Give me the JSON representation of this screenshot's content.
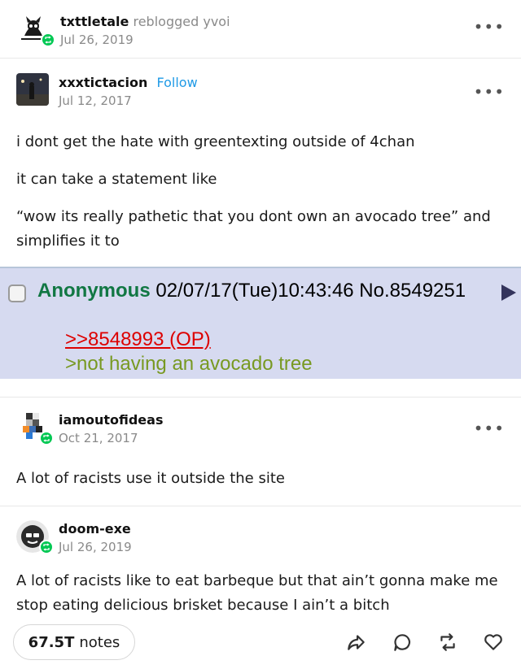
{
  "reblogger": {
    "name": "txttletale",
    "action": "reblogged",
    "source": "yvoi",
    "date": "Jul 26, 2019"
  },
  "posts": [
    {
      "author": "xxxtictacion",
      "follow_label": "Follow",
      "date": "Jul 12, 2017",
      "paragraphs": [
        "i dont get the hate with greentexting outside of 4chan",
        "it can take a statement like",
        "“wow its really pathetic that you dont own an avocado tree” and simplifies it to"
      ],
      "chan_post": {
        "name": "Anonymous",
        "meta": "02/07/17(Tue)10:43:46 No.8549251",
        "reply_link": ">>8548993 (OP)",
        "greentext": ">not having an avocado tree"
      }
    },
    {
      "author": "iamoutofideas",
      "date": "Oct 21, 2017",
      "paragraphs": [
        "A lot of racists use it outside the site"
      ]
    },
    {
      "author": "doom-exe",
      "date": "Jul 26, 2019",
      "paragraphs": [
        "A lot of racists like to eat barbeque but that ain’t gonna make me stop eating delicious brisket because I ain’t a bitch"
      ]
    }
  ],
  "footer": {
    "notes_count": "67.5T",
    "notes_label": "notes",
    "icons": [
      "share-icon",
      "reply-icon",
      "reblog-icon",
      "like-icon"
    ]
  },
  "more_glyph": "•••",
  "colors": {
    "follow": "#1f9ae6",
    "reblog_badge": "#00c853",
    "chan_bg": "#d6daf0",
    "chan_name": "#117743",
    "chan_link": "#dd0000",
    "greentext": "#789922"
  }
}
